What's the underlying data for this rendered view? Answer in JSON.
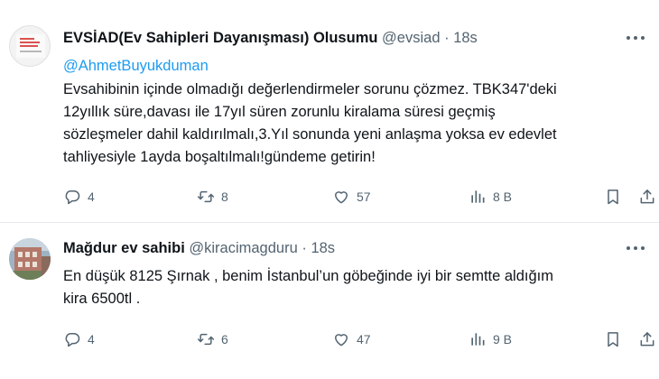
{
  "tweets": [
    {
      "name": "EVSİAD(Ev Sahipleri Dayanışması) Olusumu",
      "handle": "@evsiad",
      "dot": "·",
      "time": "18s",
      "mention": "@AhmetBuyukduman",
      "lines": [
        "Evsahibinin içinde olmadığı değerlendirmeler sorunu çözmez. TBK347'deki",
        "12yıllık süre,davası ile 17yıl süren zorunlu kiralama süresi geçmiş",
        "sözleşmeler dahil kaldırılmalı,3.Yıl sonunda yeni anlaşma yoksa ev edevlet",
        "tahliyesiyle 1ayda boşaltılmalı!gündeme getirin!"
      ],
      "replies": "4",
      "retweets": "8",
      "likes": "57",
      "views": "8 B"
    },
    {
      "name": "Mağdur ev sahibi",
      "handle": "@kiracimagduru",
      "dot": "·",
      "time": "18s",
      "lines": [
        "En düşük 8125 Şırnak , benim İstanbul’un göbeğinde iyi bir semtte aldığım",
        "kira 6500tl ."
      ],
      "replies": "4",
      "retweets": "6",
      "likes": "47",
      "views": "9 B"
    }
  ],
  "colors": {
    "text": "#0f1419",
    "secondary": "#536471",
    "link": "#1d9bf0",
    "divider": "#e6e9ec"
  },
  "icons": [
    "reply-icon",
    "retweet-icon",
    "like-icon",
    "views-icon",
    "bookmark-icon",
    "share-icon",
    "more-icon"
  ]
}
